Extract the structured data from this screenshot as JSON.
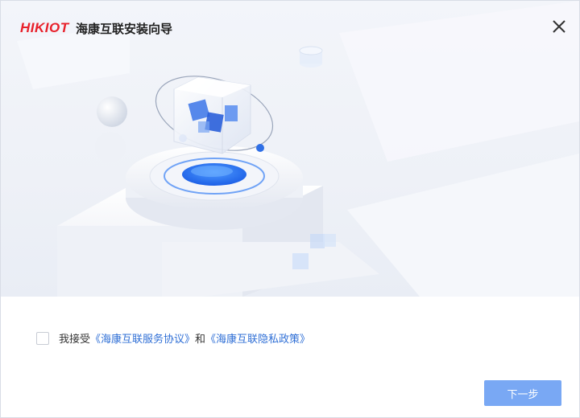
{
  "header": {
    "logo_text_a": "HIK",
    "logo_text_b": "IOT",
    "title": "海康互联安装向导",
    "close_icon": "close-icon"
  },
  "colors": {
    "brand_red": "#e8202a",
    "link_blue": "#2f6fd6",
    "button_blue": "#79a8f4"
  },
  "agreement": {
    "checked": false,
    "prefix": "我接受",
    "service_link": "《海康互联服务协议》",
    "conjunction": "和",
    "privacy_link": "《海康互联隐私政策》"
  },
  "footer": {
    "next_label": "下一步"
  }
}
